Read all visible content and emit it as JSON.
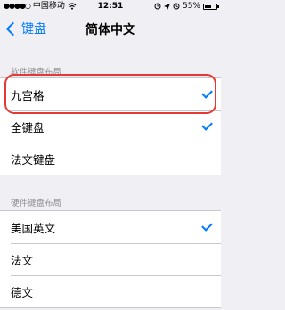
{
  "status_bar": {
    "signal": "●●●●○",
    "carrier": "中国移动",
    "wifi_icon": "wifi-icon",
    "time": "12:51",
    "battery": "55%",
    "battery_level": 0.55
  },
  "nav": {
    "back_label": "键盘",
    "title": "简体中文"
  },
  "software_section": {
    "header": "软件键盘布局",
    "items": [
      {
        "label": "九宫格",
        "checked": true
      },
      {
        "label": "全键盘",
        "checked": true
      },
      {
        "label": "法文键盘",
        "checked": false
      }
    ]
  },
  "hardware_section": {
    "header": "硬件键盘布局",
    "items": [
      {
        "label": "美国英文",
        "checked": true
      },
      {
        "label": "法文",
        "checked": false
      },
      {
        "label": "德文",
        "checked": false
      }
    ]
  },
  "colors": {
    "accent": "#007aff",
    "highlight": "#e53935",
    "background": "#efeff4"
  }
}
